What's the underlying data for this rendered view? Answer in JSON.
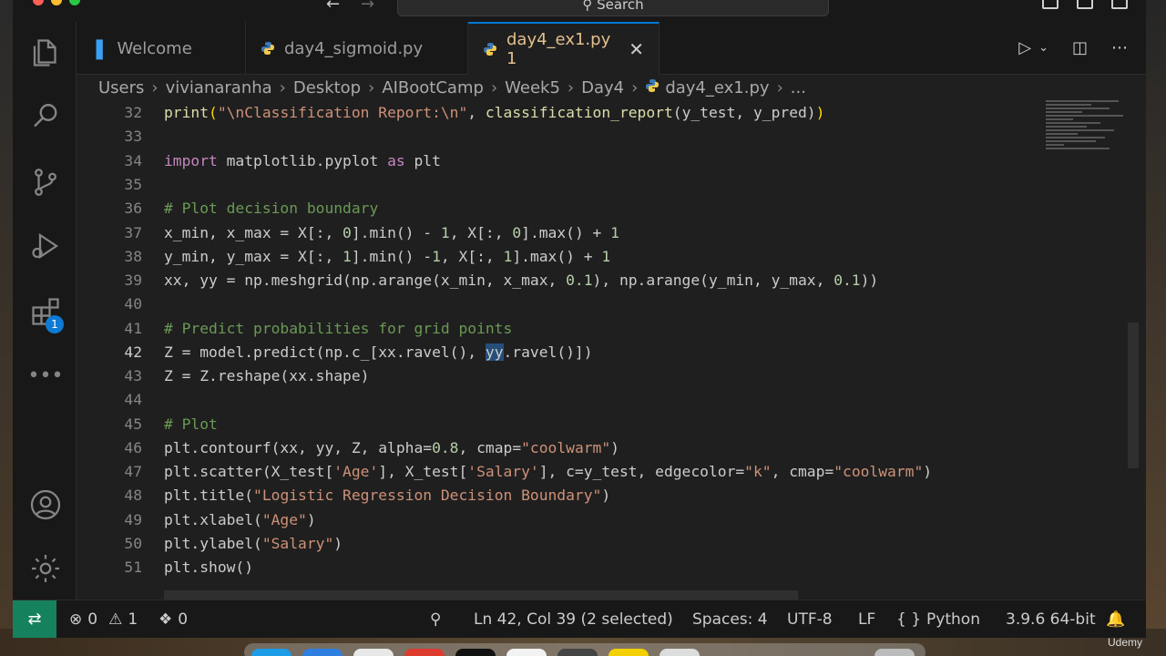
{
  "titlebar": {
    "search_label": "Search"
  },
  "activity": {
    "extensions_badge": "1"
  },
  "tabs": [
    {
      "label": "Welcome"
    },
    {
      "label": "day4_sigmoid.py"
    },
    {
      "label": "day4_ex1.py 1",
      "active": true
    }
  ],
  "breadcrumb": [
    "Users",
    "vivianaranha",
    "Desktop",
    "AIBootCamp",
    "Week5",
    "Day4",
    "day4_ex1.py",
    "..."
  ],
  "code_lines": [
    {
      "n": "32"
    },
    {
      "n": "33"
    },
    {
      "n": "34"
    },
    {
      "n": "35"
    },
    {
      "n": "36"
    },
    {
      "n": "37"
    },
    {
      "n": "38"
    },
    {
      "n": "39"
    },
    {
      "n": "40"
    },
    {
      "n": "41"
    },
    {
      "n": "42"
    },
    {
      "n": "43"
    },
    {
      "n": "44"
    },
    {
      "n": "45"
    },
    {
      "n": "46"
    },
    {
      "n": "47"
    },
    {
      "n": "48"
    },
    {
      "n": "49"
    },
    {
      "n": "50"
    },
    {
      "n": "51"
    }
  ],
  "code": {
    "l32_a": "print",
    "l32_b": "(",
    "l32_c": "\"\\nClassification Report:\\n\"",
    "l32_d": ", ",
    "l32_e": "classification_report",
    "l32_f": "(y_test, y_pred)",
    "l32_g": ")",
    "l34_a": "import",
    "l34_b": " matplotlib.pyplot ",
    "l34_c": "as",
    "l34_d": " plt",
    "l36": "# Plot decision boundary",
    "l37_a": "x_min, x_max = X[:, ",
    "l37_b": "0",
    "l37_c": "].min() - ",
    "l37_d": "1",
    "l37_e": ", X[:, ",
    "l37_f": "0",
    "l37_g": "].max() + ",
    "l37_h": "1",
    "l38_a": "y_min, y_max = X[:, ",
    "l38_b": "1",
    "l38_c": "].min() -",
    "l38_d": "1",
    "l38_e": ", X[:, ",
    "l38_f": "1",
    "l38_g": "].max() + ",
    "l38_h": "1",
    "l39_a": "xx, yy = np.meshgrid(np.arange(x_min, x_max, ",
    "l39_b": "0.1",
    "l39_c": "), np.arange(y_min, y_max, ",
    "l39_d": "0.1",
    "l39_e": "))",
    "l41": "# Predict probabilities for grid points",
    "l42_a": "Z = model.predict(np.c_[xx.ravel(), ",
    "l42_b": "yy",
    "l42_c": ".ravel()])",
    "l43": "Z = Z.reshape(xx.shape)",
    "l45": "# Plot",
    "l46_a": "plt.contourf(xx, yy, Z, alpha=",
    "l46_b": "0.8",
    "l46_c": ", cmap=",
    "l46_d": "\"coolwarm\"",
    "l46_e": ")",
    "l47_a": "plt.scatter(X_test[",
    "l47_b": "'Age'",
    "l47_c": "], X_test[",
    "l47_d": "'Salary'",
    "l47_e": "], c=y_test, edgecolor=",
    "l47_f": "\"k\"",
    "l47_g": ", cmap=",
    "l47_h": "\"coolwarm\"",
    "l47_i": ")",
    "l48_a": "plt.title(",
    "l48_b": "\"Logistic Regression Decision Boundary\"",
    "l48_c": ")",
    "l49_a": "plt.xlabel(",
    "l49_b": "\"Age\"",
    "l49_c": ")",
    "l50_a": "plt.ylabel(",
    "l50_b": "\"Salary\"",
    "l50_c": ")",
    "l51": "plt.show()"
  },
  "status": {
    "errors": "0",
    "warnings": "1",
    "ports": "0",
    "cursor": "Ln 42, Col 39 (2 selected)",
    "spaces": "Spaces: 4",
    "encoding": "UTF-8",
    "eol": "LF",
    "language": "Python",
    "interpreter": "3.9.6 64-bit"
  },
  "watermark": "Udemy",
  "colors": {
    "accent": "#0078d4",
    "modified_tab": "#e2c08d",
    "remote": "#16825d",
    "badge": "#0e7ad3"
  }
}
